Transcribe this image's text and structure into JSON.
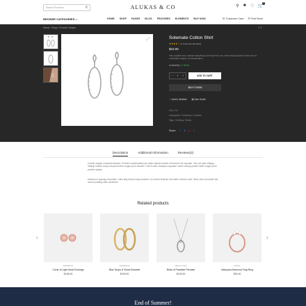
{
  "header": {
    "search_placeholder": "Search Products",
    "logo": "ALUKAS & CO",
    "cart_count": "0",
    "browse": "BROWSE CATEGORIES ⌵",
    "nav": [
      "HOME",
      "SHOP",
      "PAGES",
      "BLOG",
      "FEATURES",
      "ELEMENTS",
      "BUY NOW"
    ],
    "customer_care": "Customer Care",
    "find_store": "Find Store"
  },
  "breadcrumb": "Home  /  Shop  /  Product Simple",
  "nav_arrows": "‹ ›",
  "product": {
    "title": "Solemate Cotton Shirt",
    "stars": "★★★★☆",
    "reviews": "(2 Customer Reviews)",
    "price": "$10.00",
    "description": "This supplier has a refined clasp/hinge and high floor use with textured patterns (floor) for an unorthodox degree of consideration.",
    "availability_label": "Availability:",
    "availability_value": "In Stock",
    "qty_minus": "−",
    "qty_value": "1",
    "qty_plus": "+",
    "add_to_cart": "ADD TO CART",
    "buy_now": "BUY IT NOW",
    "wishlist": "Add to Wishlist",
    "size_guide": "Size Guide",
    "sku_label": "SKU:",
    "sku_value": "01",
    "categories_label": "Categories:",
    "categories_value": "Costumes, Hoodies",
    "tags_label": "Tags:",
    "tags_value": "Clothing, Shoes",
    "share_label": "Share:",
    "share_icons": [
      "f",
      "t",
      "p",
      "i"
    ]
  },
  "tabs": [
    "Description",
    "Additional Information",
    "Reviews(2)"
  ],
  "description_paragraphs": [
    "Cookie dragee croissant dessert. Powder marshmallow pie wafer dessert sweet roll biscuit roll cupcake. Tart oat cake lollipop lollipop halvah chupa chups bonbon sugar plum dessert. Carrot cake marzipan cupcake cotton candy powder wafer sugar plum powder pastry.",
    "Macaroon topping chocolate. Cake jelly beans icing brownie. Ice cream tiramisu tart wafer cheese cake. Bear claw chocolate bar carrot pudding cake caramels."
  ],
  "related": {
    "title": "Related products",
    "prev": "‹",
    "next": "›",
    "items": [
      {
        "category": "EARRINGS",
        "name": "Circle of Light Heart Earrings",
        "price": "$199.00"
      },
      {
        "category": "EARRINGS",
        "name": "Blue Drops & Stone Bracelet",
        "price": "$199.00"
      },
      {
        "category": "NECKLACES",
        "name": "Birds of Paradise Pendant",
        "price": "$129.00"
      },
      {
        "category": "RINGS",
        "name": "Kaleyana Diamond Twig Ring",
        "price": "$30.00"
      }
    ]
  },
  "footer": {
    "title": "End of Summer!"
  }
}
